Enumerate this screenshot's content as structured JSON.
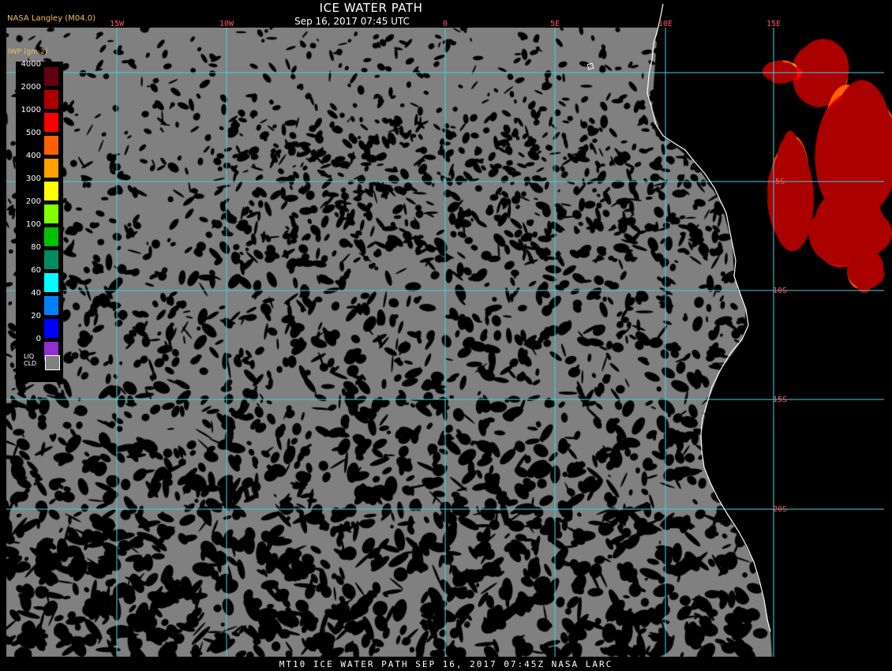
{
  "header": {
    "title": "ICE WATER PATH",
    "subtitle": "Sep 16, 2017 07:45 UTC",
    "producer": "NASA Langley (M04.0)"
  },
  "footer": {
    "text": "MT10  ICE WATER PATH  SEP 16, 2017 07:45Z  NASA LARC"
  },
  "legend": {
    "unit": "IWP (gm-2)",
    "items": [
      {
        "label": "4000",
        "color": "#600010"
      },
      {
        "label": "2000",
        "color": "#aa0000"
      },
      {
        "label": "1000",
        "color": "#ff0000"
      },
      {
        "label": "500",
        "color": "#ff6000"
      },
      {
        "label": "400",
        "color": "#ffa000"
      },
      {
        "label": "300",
        "color": "#ffff00"
      },
      {
        "label": "200",
        "color": "#80ff00"
      },
      {
        "label": "100",
        "color": "#00c000"
      },
      {
        "label": "80",
        "color": "#008c60"
      },
      {
        "label": "60",
        "color": "#00ffff"
      },
      {
        "label": "40",
        "color": "#0080ff"
      },
      {
        "label": "20",
        "color": "#0000ff"
      },
      {
        "label": "0",
        "color": "#9030d0"
      }
    ],
    "liq_label": "LIQ CLD",
    "liq_color": "#808080"
  },
  "grid": {
    "longitudes": [
      "15W",
      "10W",
      "0",
      "5E",
      "10E",
      "15E"
    ],
    "latitudes": [
      "5S",
      "10S",
      "15S",
      "20S"
    ],
    "color": "#40d0e0"
  },
  "colors": {
    "ocean": "#000000",
    "cloud": "#808080",
    "coast": "#ffffff"
  }
}
